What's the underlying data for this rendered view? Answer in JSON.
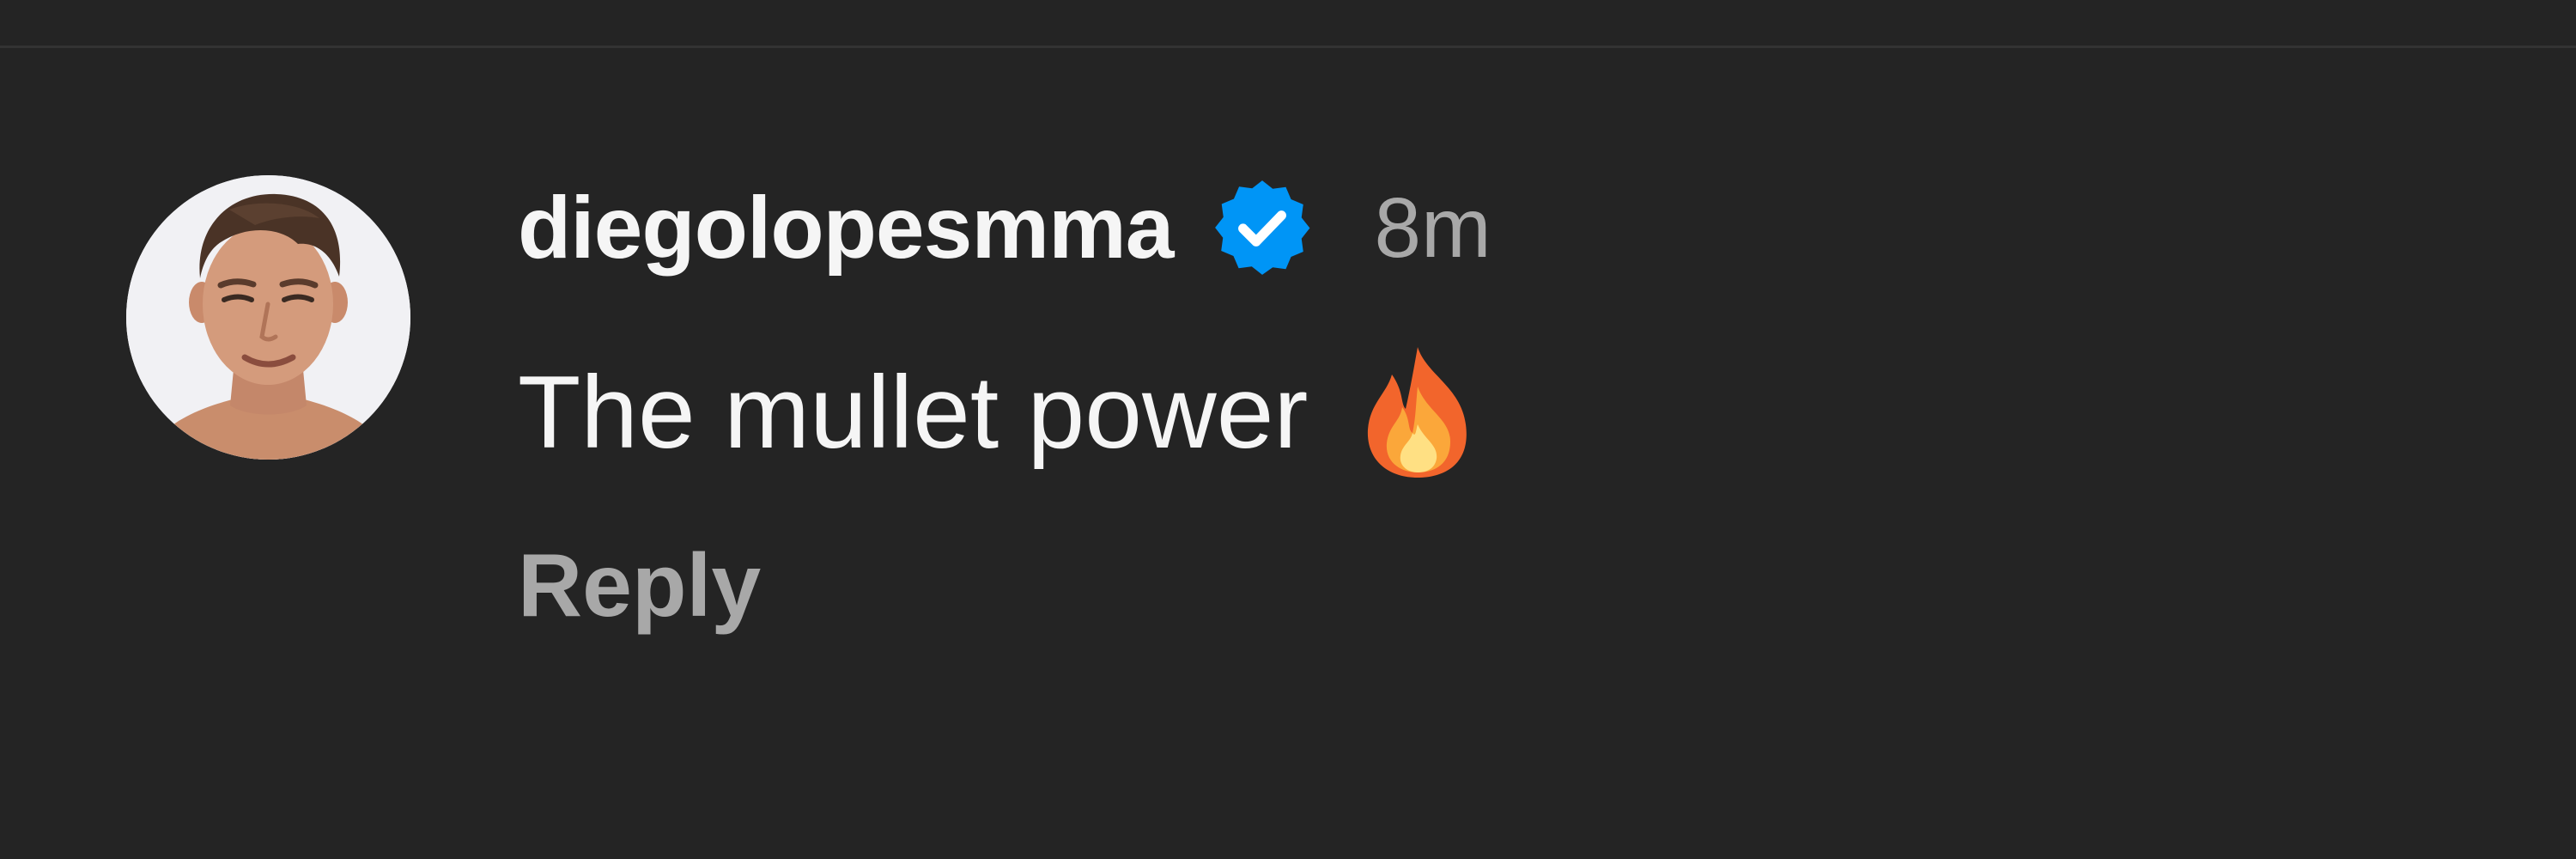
{
  "comment": {
    "username": "diegolopesmma",
    "verified": true,
    "timestamp": "8m",
    "text": "The mullet power",
    "emoji": "fire-emoji",
    "reply_label": "Reply"
  },
  "colors": {
    "background": "#242424",
    "primary_text": "#f5f5f5",
    "secondary_text": "#a8a8a8",
    "verified_badge": "#0095f6"
  }
}
